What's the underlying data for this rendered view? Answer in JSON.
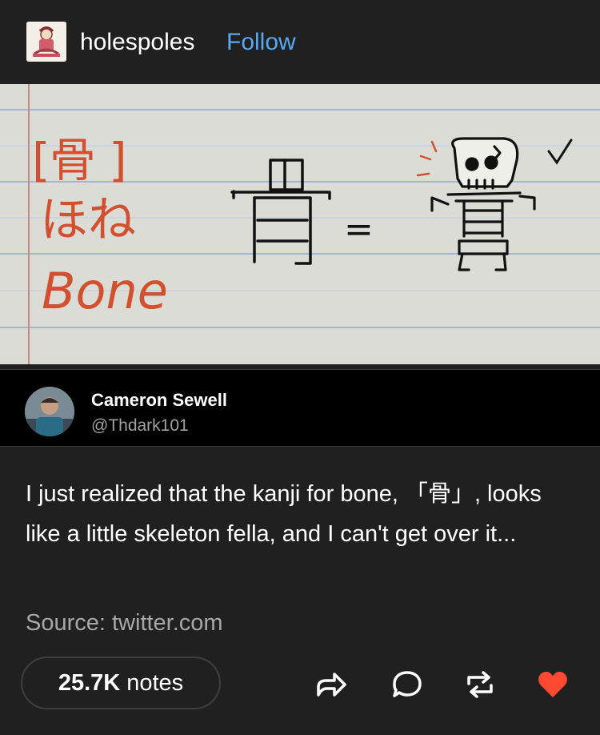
{
  "header": {
    "blog_name": "holespoles",
    "follow_label": "Follow"
  },
  "note_image": {
    "kanji": "骨",
    "hiragana": "ほね",
    "english": "Bone",
    "equals": "="
  },
  "tweet": {
    "author_name": "Cameron Sewell",
    "author_handle": "@Thdark101"
  },
  "post": {
    "text": "I just realized that the kanji for bone, 「骨」, looks like a little skeleton fella, and I can't get over it...",
    "source": "Source: twitter.com"
  },
  "footer": {
    "notes_count": "25.7K",
    "notes_label": "notes",
    "icons": [
      "share-icon",
      "reply-icon",
      "reblog-icon",
      "like-heart-icon"
    ]
  },
  "colors": {
    "background": "#202020",
    "follow_link": "#5aa7ef",
    "heart": "#ff4930",
    "paper": "#dcdcd6",
    "ink_red": "#d1502f"
  }
}
